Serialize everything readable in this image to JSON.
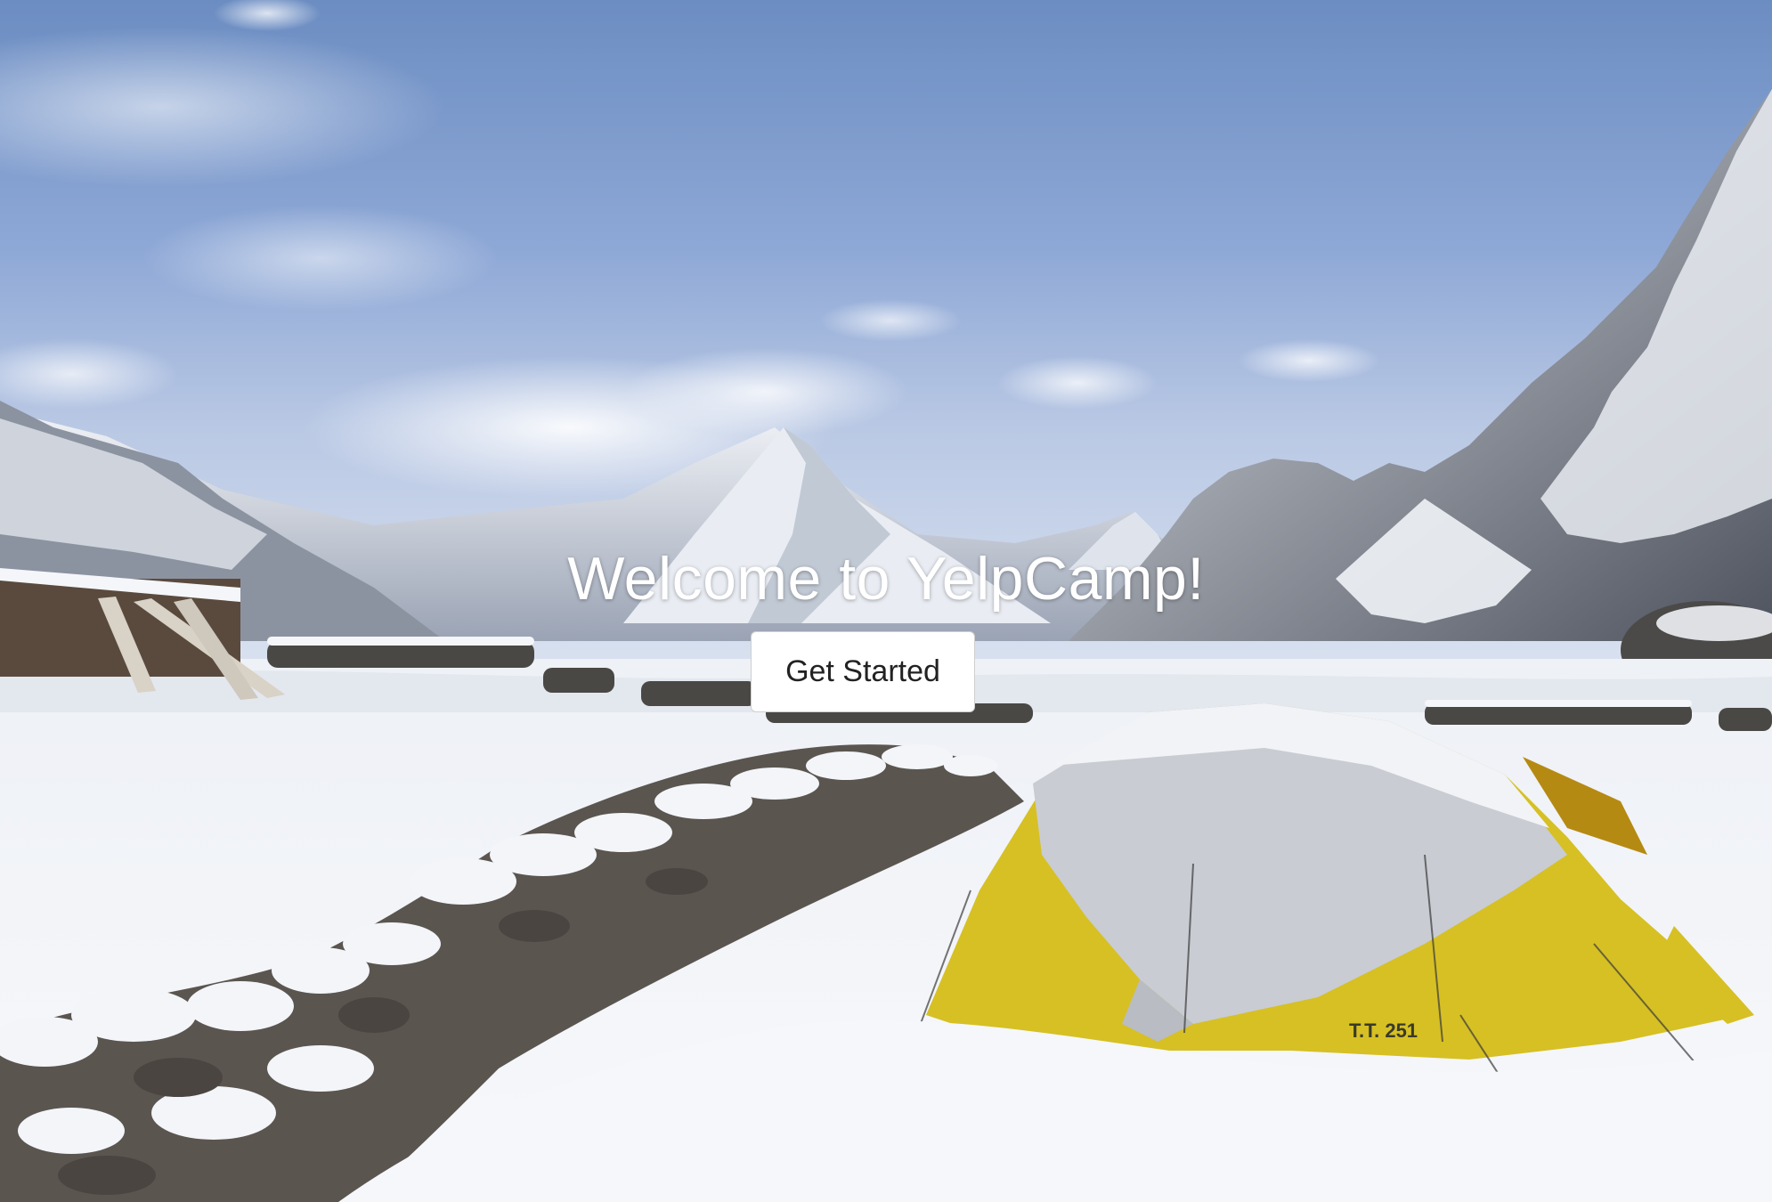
{
  "landing": {
    "title": "Welcome to YelpCamp!",
    "button_label": "Get Started",
    "tent_label": "T.T. 251"
  },
  "background": {
    "description": "snowy mountain campsite",
    "colors": {
      "sky_top": "#6f90c4",
      "sky_mid": "#aebfde",
      "snow": "#f4f6fa",
      "tent_yellow": "#d7c126",
      "rock": "#5a5650",
      "button_bg": "#ffffff",
      "button_text": "#222222",
      "title_text": "#ffffff"
    }
  }
}
